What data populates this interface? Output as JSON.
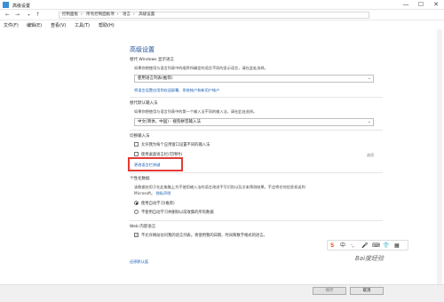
{
  "window": {
    "title": "高级设置",
    "controls": {
      "minimize": "—",
      "maximize": "☐",
      "close": "✕"
    }
  },
  "address": {
    "nav": {
      "back": "←",
      "forward": "→",
      "up": "↑"
    },
    "crumbs": [
      "控制面板",
      "所有控制面板项",
      "语言",
      "高级设置"
    ]
  },
  "menu": {
    "file": "文件(F)",
    "edit": "编辑(E)",
    "view": "查看(V)",
    "tools": "工具(T)",
    "help": "帮助(H)"
  },
  "main": {
    "heading": "高级设置",
    "display_lang": {
      "title": "替代 Windows 显示语言",
      "desc": "如果你想使用与语言列表中的顺序所确定的语言不同的显示语言，请在此处选择。",
      "select_value": "使用语言列表(推荐)",
      "link": "将语言设置应用到欢迎屏幕、系统帐户和新用户帐户"
    },
    "default_input": {
      "title": "替代默认输入法",
      "desc": "如果你想使用与语言列表中的第一个输入法不同的输入法，请在此处选择。",
      "select_value": "中文(简体，中国) - 搜狗拼音输入法"
    },
    "switch_input": {
      "title": "切换输入法",
      "opt1": "允许我为每个应用窗口设置不同的输入法",
      "opt2": "使用桌面语言栏(可用时)",
      "opt2_side": "选项",
      "link": "更改语言栏热键"
    },
    "personalization": {
      "title": "个性化数据",
      "desc1": "该数据仅用于在此电脑上为不使用输入法的语言改进手写识别以及文本预测结果。不会将任何信息发送到",
      "desc2": "Microsoft。",
      "privacy": "隐私声明",
      "radio1": "使用自动学习(推荐)",
      "radio2": "不使用自动学习并删除以前收集的所有数据"
    },
    "web_lang": {
      "title": "Web 内容语言",
      "opt": "不允许网站访问我的语言列表。将使用我的日期、时间和数字格式的语言。"
    },
    "restore": "还原默认值"
  },
  "footer": {
    "save": "保存",
    "cancel": "取消"
  },
  "ime_bar": {
    "logo": "S",
    "mode": "中",
    "punct": "·,",
    "mic": "🎤",
    "keyboard": "⌨",
    "skin": "👕",
    "tools": "▦"
  },
  "watermark": "Bai度经验"
}
